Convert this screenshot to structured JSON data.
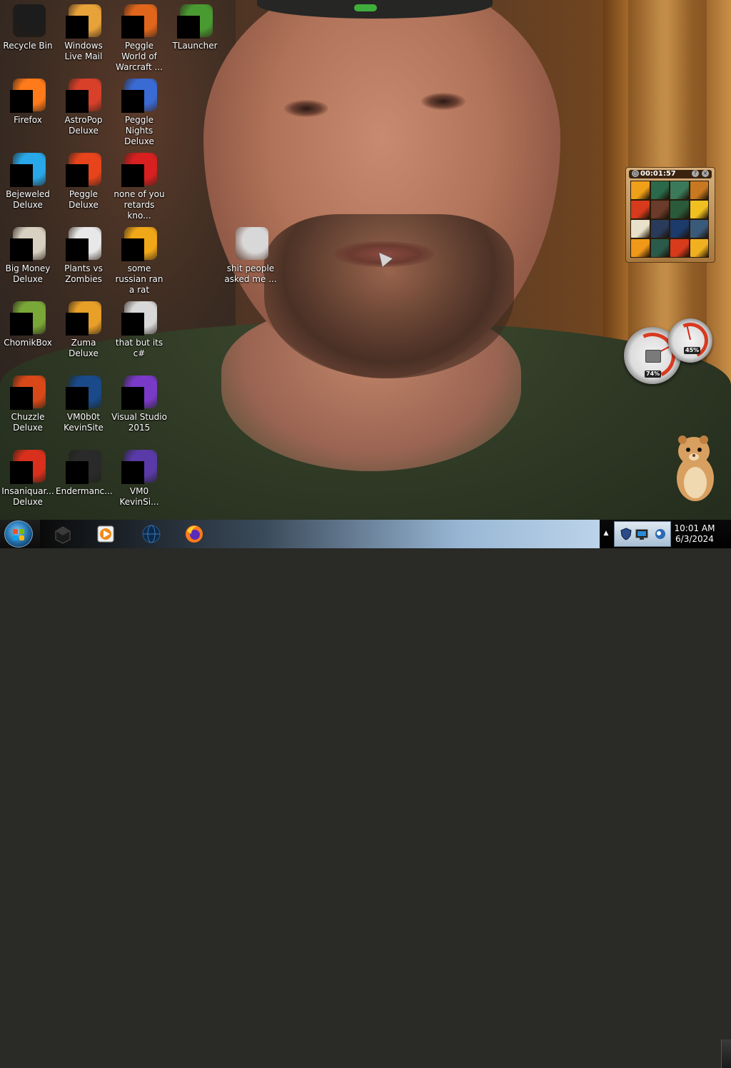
{
  "desktop": {
    "icons": [
      {
        "label": "Recycle Bin",
        "icon": "recycle-bin-icon",
        "color": "#1c1c1c"
      },
      {
        "label": "Windows Live Mail",
        "icon": "windows-live-mail-icon",
        "color": "#e8a23a"
      },
      {
        "label": "Peggle World of Warcraft ...",
        "icon": "peggle-wow-icon",
        "color": "#e0661c"
      },
      {
        "label": "TLauncher",
        "icon": "tlauncher-icon",
        "color": "#4a9a32"
      },
      {
        "label": "Firefox",
        "icon": "firefox-icon",
        "color": "#ff7a1a"
      },
      {
        "label": "AstroPop Deluxe",
        "icon": "astropop-icon",
        "color": "#d8402a"
      },
      {
        "label": "Peggle Nights Deluxe",
        "icon": "peggle-nights-icon",
        "color": "#3a6ad4"
      },
      {
        "label": "Bejeweled Deluxe",
        "icon": "bejeweled-icon",
        "color": "#28a8e8"
      },
      {
        "label": "Peggle Deluxe",
        "icon": "peggle-icon",
        "color": "#e8441c"
      },
      {
        "label": "none of you retards kno...",
        "icon": "shortcut-icon",
        "color": "#d82020"
      },
      {
        "label": "Big Money Deluxe",
        "icon": "big-money-icon",
        "color": "#d8d0c0"
      },
      {
        "label": "Plants vs Zombies",
        "icon": "plants-vs-zombies-icon",
        "color": "#e8e8e8"
      },
      {
        "label": "some russian ran a rat",
        "icon": "java-file-icon",
        "color": "#f0a818"
      },
      {
        "label": "shit people asked me ...",
        "icon": "folder-icon",
        "color": "#d8d8d8"
      },
      {
        "label": "ChomikBox",
        "icon": "chomikbox-icon",
        "color": "#7aa838"
      },
      {
        "label": "Zuma Deluxe",
        "icon": "zuma-icon",
        "color": "#e8a028"
      },
      {
        "label": "that but its c#",
        "icon": "copy-icon",
        "color": "#d8d8d8"
      },
      {
        "label": "Chuzzle Deluxe",
        "icon": "chuzzle-icon",
        "color": "#d84818"
      },
      {
        "label": "VM0b0t KevinSite",
        "icon": "vm-icon",
        "color": "#1a4a8a"
      },
      {
        "label": "Visual Studio 2015",
        "icon": "visual-studio-icon",
        "color": "#7a3ac8"
      },
      {
        "label": "Insaniquar... Deluxe",
        "icon": "insaniquarium-icon",
        "color": "#d8301c"
      },
      {
        "label": "Endermanc...",
        "icon": "terminal-icon",
        "color": "#2a2a2a"
      },
      {
        "label": "VM0 KevinSi...",
        "icon": "vm-file-icon",
        "color": "#5a3aa8"
      }
    ],
    "cursor_icon": "mouse-pointer-icon"
  },
  "gadgets": {
    "puzzle": {
      "time": "00:01:57",
      "close_icon": "close-icon",
      "help_icon": "help-icon",
      "tile_colors": [
        "#f0a018",
        "#2a6a4a",
        "#3a7a5a",
        "#c87820",
        "#d83a1c",
        "#6a3a2a",
        "#2a5a3a",
        "#f0c020",
        "#e8e0c8",
        "#2a3a5a",
        "#1c3a6a",
        "#3a5a7a",
        "#f09818",
        "#2a5a4a",
        "#d83a1c",
        "#f0b020"
      ]
    },
    "meters": {
      "cpu_value": "74%",
      "ram_value": "45%",
      "cpu": 0.74,
      "ram": 0.45
    },
    "hamster_icon": "hamster-mascot-icon"
  },
  "taskbar": {
    "start_icon": "windows-start-icon",
    "pinned": [
      {
        "name": "taskbar-app-black-box",
        "icon": "black-box-icon"
      },
      {
        "name": "taskbar-media-player",
        "icon": "media-player-icon"
      },
      {
        "name": "taskbar-globe-app",
        "icon": "globe-icon"
      },
      {
        "name": "taskbar-firefox",
        "icon": "firefox-icon"
      }
    ],
    "tray": {
      "chevron": "▲",
      "icons": [
        "shield-icon",
        "network-icon",
        "messenger-icon"
      ]
    },
    "clock": {
      "time": "10:01 AM",
      "date": "6/3/2024"
    }
  }
}
